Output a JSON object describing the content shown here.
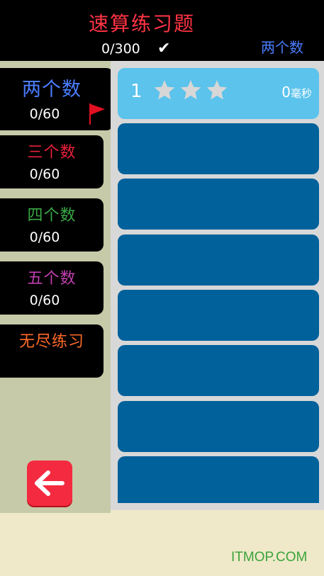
{
  "header": {
    "title": "速算练习题",
    "progress": "0/300",
    "check_icon": "checkmark-icon",
    "current_mode": "两个数"
  },
  "modes": [
    {
      "name": "两个数",
      "score": "0/60",
      "color": "#4a7dff",
      "active": true
    },
    {
      "name": "三个数",
      "score": "0/60",
      "color": "#e8203a"
    },
    {
      "name": "四个数",
      "score": "0/60",
      "color": "#3aa845"
    },
    {
      "name": "五个数",
      "score": "0/60",
      "color": "#c23fb0"
    },
    {
      "name": "无尽练习",
      "score": "",
      "color": "#ff6a2a"
    }
  ],
  "back_button": {
    "icon": "arrow-left-icon"
  },
  "levels": [
    {
      "number": "1",
      "stars": 0,
      "time_value": "0",
      "time_unit": "毫秒",
      "unlocked": true
    },
    {
      "unlocked": false
    },
    {
      "unlocked": false
    },
    {
      "unlocked": false
    },
    {
      "unlocked": false
    },
    {
      "unlocked": false
    },
    {
      "unlocked": false
    },
    {
      "unlocked": false
    }
  ],
  "footer": {
    "watermark": "ITMOP.COM"
  },
  "colors": {
    "topbar": "#000000",
    "title": "#ff3344",
    "unlocked_level": "#5bc3ec",
    "locked_level": "#00619b",
    "back_button": "#f42a40"
  }
}
